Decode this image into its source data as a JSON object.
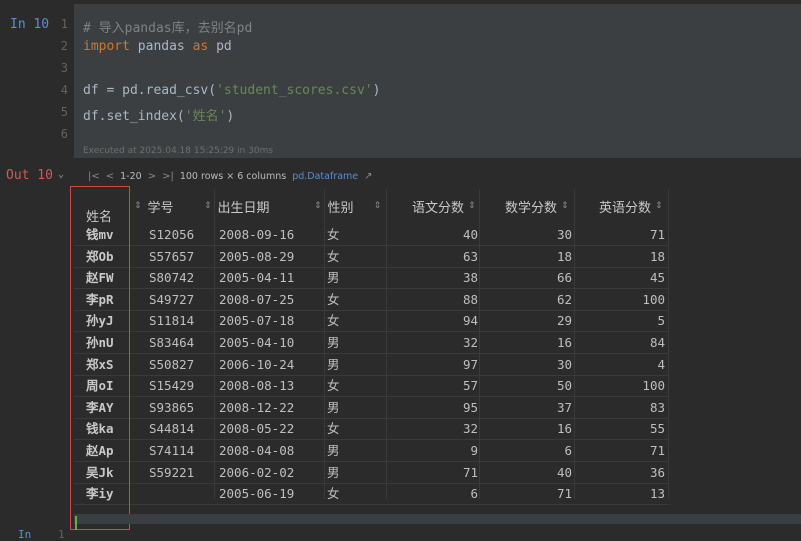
{
  "input_cell": {
    "prompt": "In 10",
    "line_numbers": [
      "1",
      "2",
      "3",
      "4",
      "5",
      "6"
    ],
    "lines": [
      {
        "type": "comment",
        "text": "# 导入pandas库，去别名pd"
      },
      {
        "type": "import",
        "kw1": "import",
        "mod": " pandas ",
        "kw2": "as",
        "alias": " pd"
      },
      {
        "type": "blank",
        "text": ""
      },
      {
        "type": "read",
        "pre": "df = pd.read_csv(",
        "str": "'student_scores.csv'",
        "post": ")"
      },
      {
        "type": "index",
        "pre": "df.set_index(",
        "str": "'姓名'",
        "post": ")"
      },
      {
        "type": "blank",
        "text": ""
      }
    ],
    "exec_info": "Executed at 2025.04.18 15:25:29 in 30ms"
  },
  "output_cell": {
    "prompt": "Out 10",
    "toolbar": {
      "first": "|<",
      "prev": "<",
      "range": "1-20",
      "next": ">",
      "last": ">|",
      "summary": "100 rows × 6 columns",
      "type_link": "pd.Dataframe",
      "arrow": "↗"
    }
  },
  "table": {
    "index_header": "姓名",
    "headers": [
      "学号",
      "出生日期",
      "性别",
      "语文分数",
      "数学分数",
      "英语分数"
    ],
    "rows": [
      [
        "钱mv",
        "S12056",
        "2008-09-16",
        "女",
        "40",
        "30",
        "71"
      ],
      [
        "郑Ob",
        "S57657",
        "2005-08-29",
        "女",
        "63",
        "18",
        "18"
      ],
      [
        "赵FW",
        "S80742",
        "2005-04-11",
        "男",
        "38",
        "66",
        "45"
      ],
      [
        "李pR",
        "S49727",
        "2008-07-25",
        "女",
        "88",
        "62",
        "100"
      ],
      [
        "孙yJ",
        "S11814",
        "2005-07-18",
        "女",
        "94",
        "29",
        "5"
      ],
      [
        "孙nU",
        "S83464",
        "2005-04-10",
        "男",
        "32",
        "16",
        "84"
      ],
      [
        "郑xS",
        "S50827",
        "2006-10-24",
        "男",
        "97",
        "30",
        "4"
      ],
      [
        "周oI",
        "S15429",
        "2008-08-13",
        "女",
        "57",
        "50",
        "100"
      ],
      [
        "李AY",
        "S93865",
        "2008-12-22",
        "男",
        "95",
        "37",
        "83"
      ],
      [
        "钱ka",
        "S44814",
        "2008-05-22",
        "女",
        "32",
        "16",
        "55"
      ],
      [
        "赵Ap",
        "S74114",
        "2008-04-08",
        "男",
        "9",
        "6",
        "71"
      ],
      [
        "吴Jk",
        "S59221",
        "2006-02-02",
        "男",
        "71",
        "40",
        "36"
      ],
      [
        "李iy",
        "",
        "2005-06-19",
        "女",
        "6",
        "71",
        "13"
      ]
    ]
  },
  "next_cell": {
    "prompt": "In",
    "line_number": "1"
  },
  "colors": {
    "accent": "#5c8dd6",
    "out": "#d95656",
    "highlight": "#d0494a"
  }
}
